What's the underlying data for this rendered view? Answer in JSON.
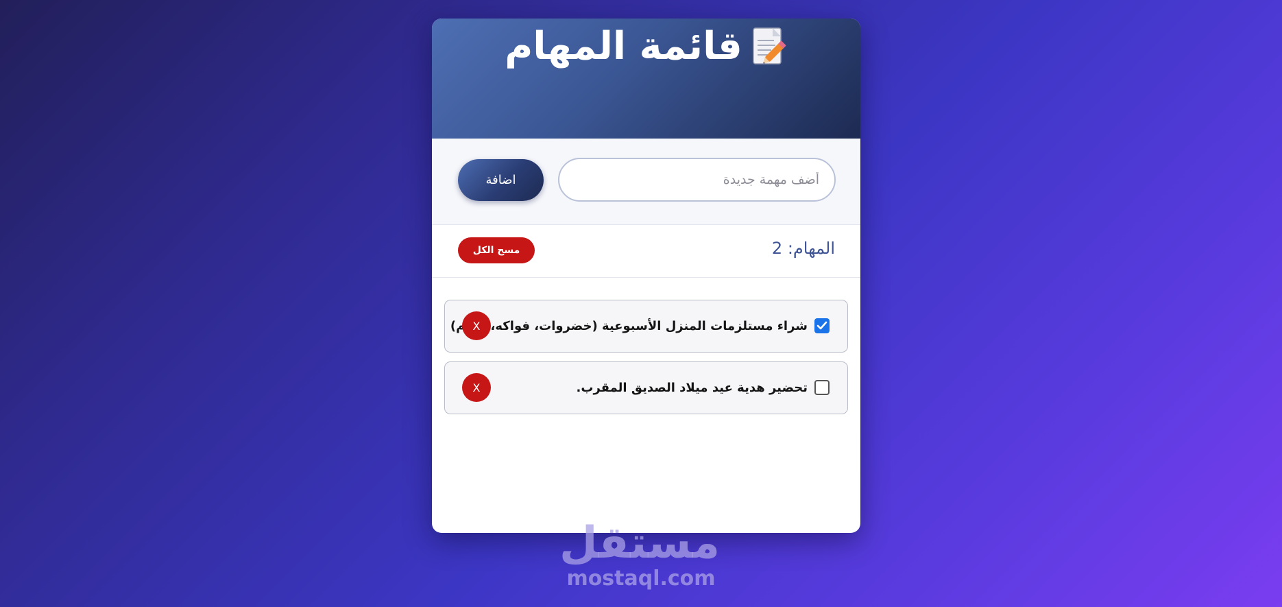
{
  "app": {
    "title": "قائمة المهام",
    "title_icon": "memo-icon"
  },
  "add_form": {
    "input_placeholder": "أضف مهمة جديدة",
    "input_value": "",
    "add_button_label": "اضافة"
  },
  "counter": {
    "label": "المهام: 2",
    "clear_all_label": "مسح الكل"
  },
  "tasks": [
    {
      "text": "شراء مستلزمات المنزل الأسبوعية (خضروات، فواكه، لحوم)",
      "completed": true,
      "delete_label": "X"
    },
    {
      "text": "تحضير هدية عيد ميلاد الصديق المقرب.",
      "completed": false,
      "delete_label": "X"
    }
  ],
  "watermark": {
    "arabic": "مستقل",
    "latin": "mostaql.com"
  },
  "colors": {
    "header_start": "#4e6fb4",
    "header_end": "#1d2a52",
    "danger": "#c61616",
    "checkbox_accent": "#1a73e8",
    "counter_text": "#3f5596"
  }
}
